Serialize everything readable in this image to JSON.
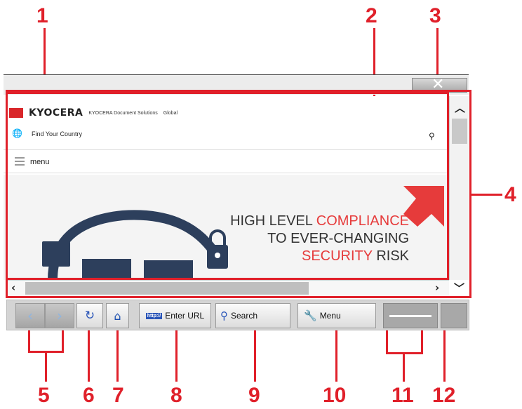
{
  "callouts": [
    "1",
    "2",
    "3",
    "4",
    "5",
    "6",
    "7",
    "8",
    "9",
    "10",
    "11",
    "12"
  ],
  "site": {
    "logo": "KYOCERA",
    "tagline": "KYOCERA Document Solutions",
    "region": "Global",
    "country_link": "Find Your Country",
    "menu_label": "menu",
    "hero": {
      "line1": "HIGH LEVEL",
      "line1_red": "COMPLIANCE",
      "line2": "TO EVER-CHANGING",
      "line3_red": "SECURITY",
      "line3": "RISK"
    }
  },
  "toolbar": {
    "enter_url": "Enter URL",
    "search": "Search",
    "menu": "Menu",
    "http_badge": "http://"
  },
  "icons": {
    "back": "chevron-left-icon",
    "forward": "chevron-right-icon",
    "reload": "reload-icon",
    "home": "home-icon",
    "close": "close-icon",
    "search": "magnifier-icon",
    "wrench": "wrench-icon"
  },
  "colors": {
    "callout": "#e0202a",
    "accent": "#2a55b8",
    "brand_red": "#d9262a"
  }
}
